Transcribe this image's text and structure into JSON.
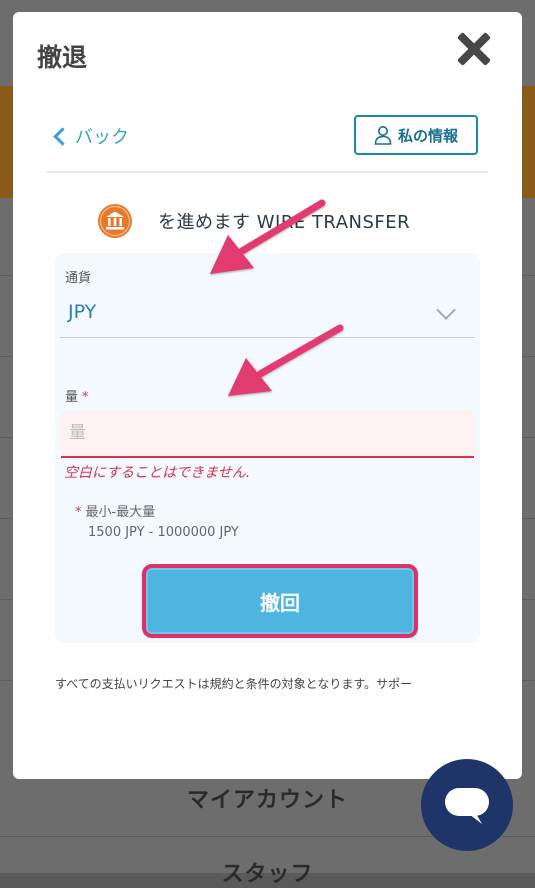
{
  "modal": {
    "title": "撤退",
    "back_label": "バック",
    "my_info_label": "私の情報",
    "method_text": "を進めます WIRE TRANSFER",
    "currency": {
      "label": "通貨",
      "selected": "JPY"
    },
    "amount": {
      "label": "量",
      "required_mark": "*",
      "placeholder": "量",
      "value": "",
      "error": "空白にすることはできません."
    },
    "limits": {
      "star": "*",
      "label": "最小-最大量",
      "value": "1500 JPY - 1000000 JPY"
    },
    "submit_label": "撤回",
    "disclaimer": "すべての支払いリクエストは規約と条件の対象となります。サポー"
  },
  "background": {
    "footer_link_1": "マイアカウント",
    "footer_link_2": "スタッフ"
  },
  "colors": {
    "accent_blue": "#3a9fd2",
    "submit_blue": "#4db5df",
    "error_red": "#d9334d",
    "annotation_pink": "#e0306a",
    "chat_navy": "#1f3569",
    "bank_icon_orange": "#e9782b"
  },
  "icons": {
    "close": "close-icon",
    "back": "chevron-left-icon",
    "person": "person-icon",
    "bank": "bank-icon",
    "dropdown": "chevron-down-icon",
    "chat": "chat-bubble-icon"
  }
}
